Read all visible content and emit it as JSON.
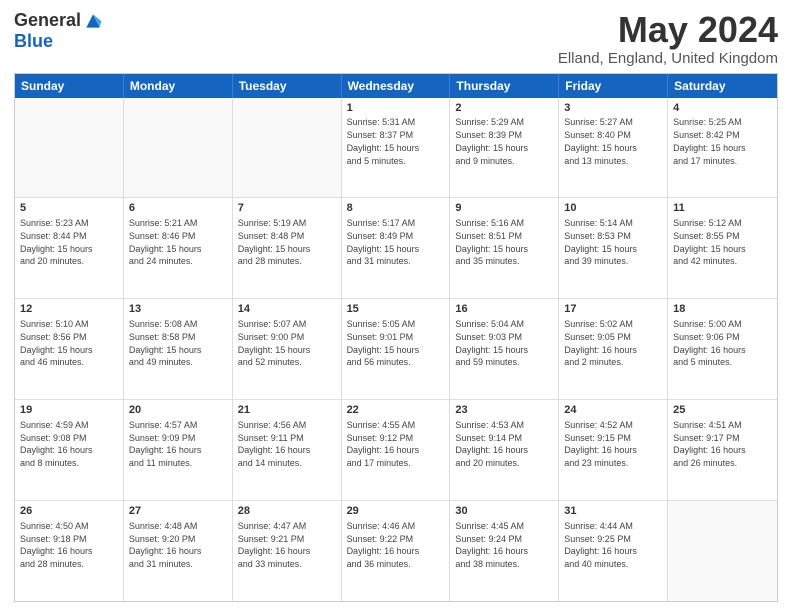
{
  "header": {
    "logo_general": "General",
    "logo_blue": "Blue",
    "month_title": "May 2024",
    "location": "Elland, England, United Kingdom"
  },
  "days_of_week": [
    "Sunday",
    "Monday",
    "Tuesday",
    "Wednesday",
    "Thursday",
    "Friday",
    "Saturday"
  ],
  "weeks": [
    [
      {
        "day": "",
        "info": ""
      },
      {
        "day": "",
        "info": ""
      },
      {
        "day": "",
        "info": ""
      },
      {
        "day": "1",
        "info": "Sunrise: 5:31 AM\nSunset: 8:37 PM\nDaylight: 15 hours\nand 5 minutes."
      },
      {
        "day": "2",
        "info": "Sunrise: 5:29 AM\nSunset: 8:39 PM\nDaylight: 15 hours\nand 9 minutes."
      },
      {
        "day": "3",
        "info": "Sunrise: 5:27 AM\nSunset: 8:40 PM\nDaylight: 15 hours\nand 13 minutes."
      },
      {
        "day": "4",
        "info": "Sunrise: 5:25 AM\nSunset: 8:42 PM\nDaylight: 15 hours\nand 17 minutes."
      }
    ],
    [
      {
        "day": "5",
        "info": "Sunrise: 5:23 AM\nSunset: 8:44 PM\nDaylight: 15 hours\nand 20 minutes."
      },
      {
        "day": "6",
        "info": "Sunrise: 5:21 AM\nSunset: 8:46 PM\nDaylight: 15 hours\nand 24 minutes."
      },
      {
        "day": "7",
        "info": "Sunrise: 5:19 AM\nSunset: 8:48 PM\nDaylight: 15 hours\nand 28 minutes."
      },
      {
        "day": "8",
        "info": "Sunrise: 5:17 AM\nSunset: 8:49 PM\nDaylight: 15 hours\nand 31 minutes."
      },
      {
        "day": "9",
        "info": "Sunrise: 5:16 AM\nSunset: 8:51 PM\nDaylight: 15 hours\nand 35 minutes."
      },
      {
        "day": "10",
        "info": "Sunrise: 5:14 AM\nSunset: 8:53 PM\nDaylight: 15 hours\nand 39 minutes."
      },
      {
        "day": "11",
        "info": "Sunrise: 5:12 AM\nSunset: 8:55 PM\nDaylight: 15 hours\nand 42 minutes."
      }
    ],
    [
      {
        "day": "12",
        "info": "Sunrise: 5:10 AM\nSunset: 8:56 PM\nDaylight: 15 hours\nand 46 minutes."
      },
      {
        "day": "13",
        "info": "Sunrise: 5:08 AM\nSunset: 8:58 PM\nDaylight: 15 hours\nand 49 minutes."
      },
      {
        "day": "14",
        "info": "Sunrise: 5:07 AM\nSunset: 9:00 PM\nDaylight: 15 hours\nand 52 minutes."
      },
      {
        "day": "15",
        "info": "Sunrise: 5:05 AM\nSunset: 9:01 PM\nDaylight: 15 hours\nand 56 minutes."
      },
      {
        "day": "16",
        "info": "Sunrise: 5:04 AM\nSunset: 9:03 PM\nDaylight: 15 hours\nand 59 minutes."
      },
      {
        "day": "17",
        "info": "Sunrise: 5:02 AM\nSunset: 9:05 PM\nDaylight: 16 hours\nand 2 minutes."
      },
      {
        "day": "18",
        "info": "Sunrise: 5:00 AM\nSunset: 9:06 PM\nDaylight: 16 hours\nand 5 minutes."
      }
    ],
    [
      {
        "day": "19",
        "info": "Sunrise: 4:59 AM\nSunset: 9:08 PM\nDaylight: 16 hours\nand 8 minutes."
      },
      {
        "day": "20",
        "info": "Sunrise: 4:57 AM\nSunset: 9:09 PM\nDaylight: 16 hours\nand 11 minutes."
      },
      {
        "day": "21",
        "info": "Sunrise: 4:56 AM\nSunset: 9:11 PM\nDaylight: 16 hours\nand 14 minutes."
      },
      {
        "day": "22",
        "info": "Sunrise: 4:55 AM\nSunset: 9:12 PM\nDaylight: 16 hours\nand 17 minutes."
      },
      {
        "day": "23",
        "info": "Sunrise: 4:53 AM\nSunset: 9:14 PM\nDaylight: 16 hours\nand 20 minutes."
      },
      {
        "day": "24",
        "info": "Sunrise: 4:52 AM\nSunset: 9:15 PM\nDaylight: 16 hours\nand 23 minutes."
      },
      {
        "day": "25",
        "info": "Sunrise: 4:51 AM\nSunset: 9:17 PM\nDaylight: 16 hours\nand 26 minutes."
      }
    ],
    [
      {
        "day": "26",
        "info": "Sunrise: 4:50 AM\nSunset: 9:18 PM\nDaylight: 16 hours\nand 28 minutes."
      },
      {
        "day": "27",
        "info": "Sunrise: 4:48 AM\nSunset: 9:20 PM\nDaylight: 16 hours\nand 31 minutes."
      },
      {
        "day": "28",
        "info": "Sunrise: 4:47 AM\nSunset: 9:21 PM\nDaylight: 16 hours\nand 33 minutes."
      },
      {
        "day": "29",
        "info": "Sunrise: 4:46 AM\nSunset: 9:22 PM\nDaylight: 16 hours\nand 36 minutes."
      },
      {
        "day": "30",
        "info": "Sunrise: 4:45 AM\nSunset: 9:24 PM\nDaylight: 16 hours\nand 38 minutes."
      },
      {
        "day": "31",
        "info": "Sunrise: 4:44 AM\nSunset: 9:25 PM\nDaylight: 16 hours\nand 40 minutes."
      },
      {
        "day": "",
        "info": ""
      }
    ]
  ]
}
